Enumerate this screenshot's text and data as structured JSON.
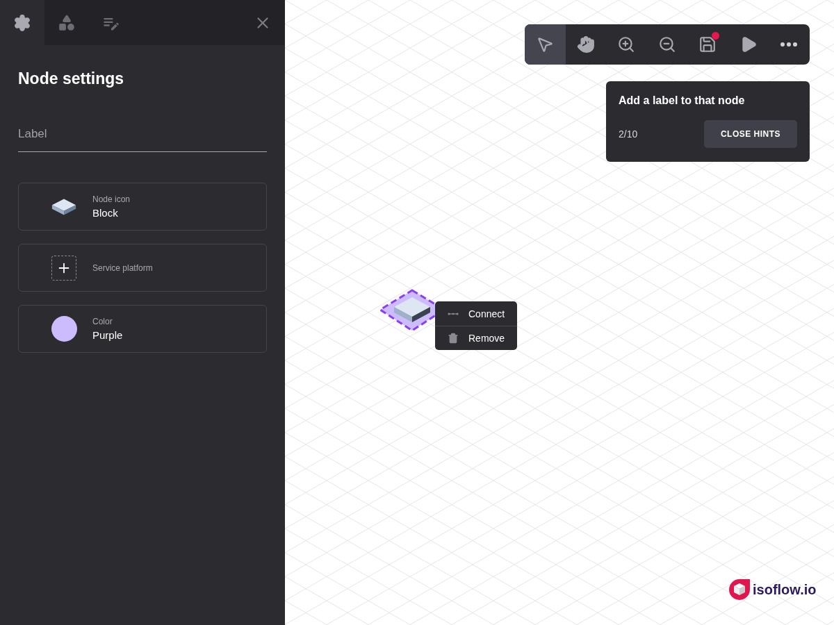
{
  "sidebar": {
    "tabs": [
      {
        "kind": "settings",
        "selected": true
      },
      {
        "kind": "shapes",
        "selected": false
      },
      {
        "kind": "notes",
        "selected": false
      }
    ],
    "title": "Node settings",
    "label_field": {
      "placeholder": "Label"
    },
    "settings": [
      {
        "kind": "icon",
        "caption": "Node icon",
        "value": "Block"
      },
      {
        "kind": "add",
        "caption": "Service platform"
      },
      {
        "kind": "color",
        "caption": "Color",
        "value": "Purple",
        "color": "#cdbcfd"
      }
    ]
  },
  "toolbar": {
    "tools": [
      {
        "kind": "select",
        "selected": true
      },
      {
        "kind": "pan",
        "selected": false
      },
      {
        "kind": "zoom-in",
        "selected": false
      },
      {
        "kind": "zoom-out",
        "selected": false
      },
      {
        "kind": "save",
        "selected": false,
        "unsaved": true
      },
      {
        "kind": "play",
        "selected": false
      },
      {
        "kind": "more",
        "selected": false
      }
    ]
  },
  "hint": {
    "title": "Add a label to that node",
    "step": "2/10",
    "button": "CLOSE HINTS"
  },
  "node": {
    "selected": true
  },
  "context_menu": [
    {
      "kind": "connect",
      "label": "Connect"
    },
    {
      "kind": "remove",
      "label": "Remove"
    }
  ],
  "logo": {
    "text": "isoflow.io"
  }
}
